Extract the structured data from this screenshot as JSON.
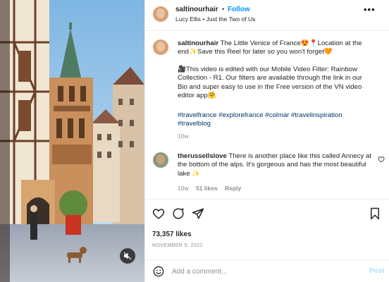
{
  "header": {
    "username": "saltinourhair",
    "separator": "•",
    "follow_label": "Follow",
    "audio": "Lucy Ellis • Just the Two of Us",
    "more_icon": "more-horizontal-icon"
  },
  "caption": {
    "username": "saltinourhair",
    "text": "The Little Venice of France😍📍Location at the end✨Save this Reel for later so you won't forget🧡",
    "text2": "🎥This video is edited with our Mobile Video Filter: Rainbow Collection - R1. Our filters are available through the link in our Bio and super easy to use in the Free version of the VN video editor app🤗",
    "hashtags": "#travelfrance #explorefrance #colmar #travelinspiration #travelblog",
    "time": "10w"
  },
  "comments": [
    {
      "username": "therussellslove",
      "text": "There is another place like this called Annecy at the bottom of the alps. It's gorgeous and has the most beautiful lake ✨",
      "time": "10w",
      "likes": "51 likes",
      "reply": "Reply"
    }
  ],
  "actions": {
    "likes": "73,357 likes",
    "date": "NOVEMBER 5, 2022"
  },
  "add_comment": {
    "placeholder": "Add a comment...",
    "post_label": "Post"
  },
  "colors": {
    "accent": "#0095f6",
    "link": "#00376b",
    "muted": "#8e8e8e",
    "post_disabled": "#b2dffc"
  }
}
